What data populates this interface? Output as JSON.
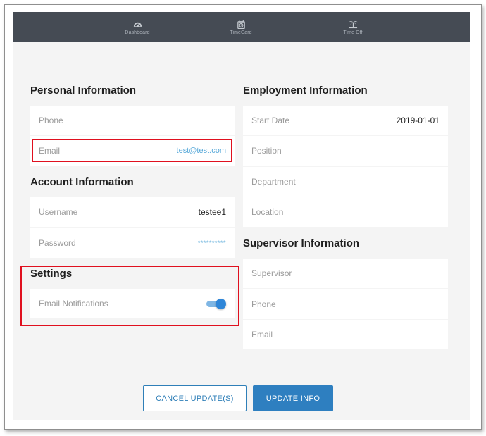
{
  "nav": {
    "items": [
      {
        "label": "Dashboard",
        "icon": "speedometer-icon"
      },
      {
        "label": "TimeCard",
        "icon": "timecard-icon"
      },
      {
        "label": "Time Off",
        "icon": "palm-tree-icon"
      }
    ]
  },
  "personal": {
    "title": "Personal Information",
    "phone_label": "Phone",
    "phone_value": "",
    "email_label": "Email",
    "email_value": "test@test.com"
  },
  "account": {
    "title": "Account Information",
    "username_label": "Username",
    "username_value": "testee1",
    "password_label": "Password",
    "password_value": "**********"
  },
  "settings": {
    "title": "Settings",
    "email_notifications_label": "Email Notifications",
    "email_notifications_on": true
  },
  "employment": {
    "title": "Employment Information",
    "start_date_label": "Start Date",
    "start_date_value": "2019-01-01",
    "position_label": "Position",
    "department_label": "Department",
    "location_label": "Location"
  },
  "supervisor": {
    "title": "Supervisor Information",
    "supervisor_label": "Supervisor",
    "phone_label": "Phone",
    "email_label": "Email"
  },
  "actions": {
    "cancel_label": "CANCEL UPDATE(S)",
    "update_label": "UPDATE INFO"
  },
  "colors": {
    "navbar": "#454b54",
    "accent": "#2e7fc0",
    "highlight": "#e0101f",
    "link": "#58a9d9"
  }
}
